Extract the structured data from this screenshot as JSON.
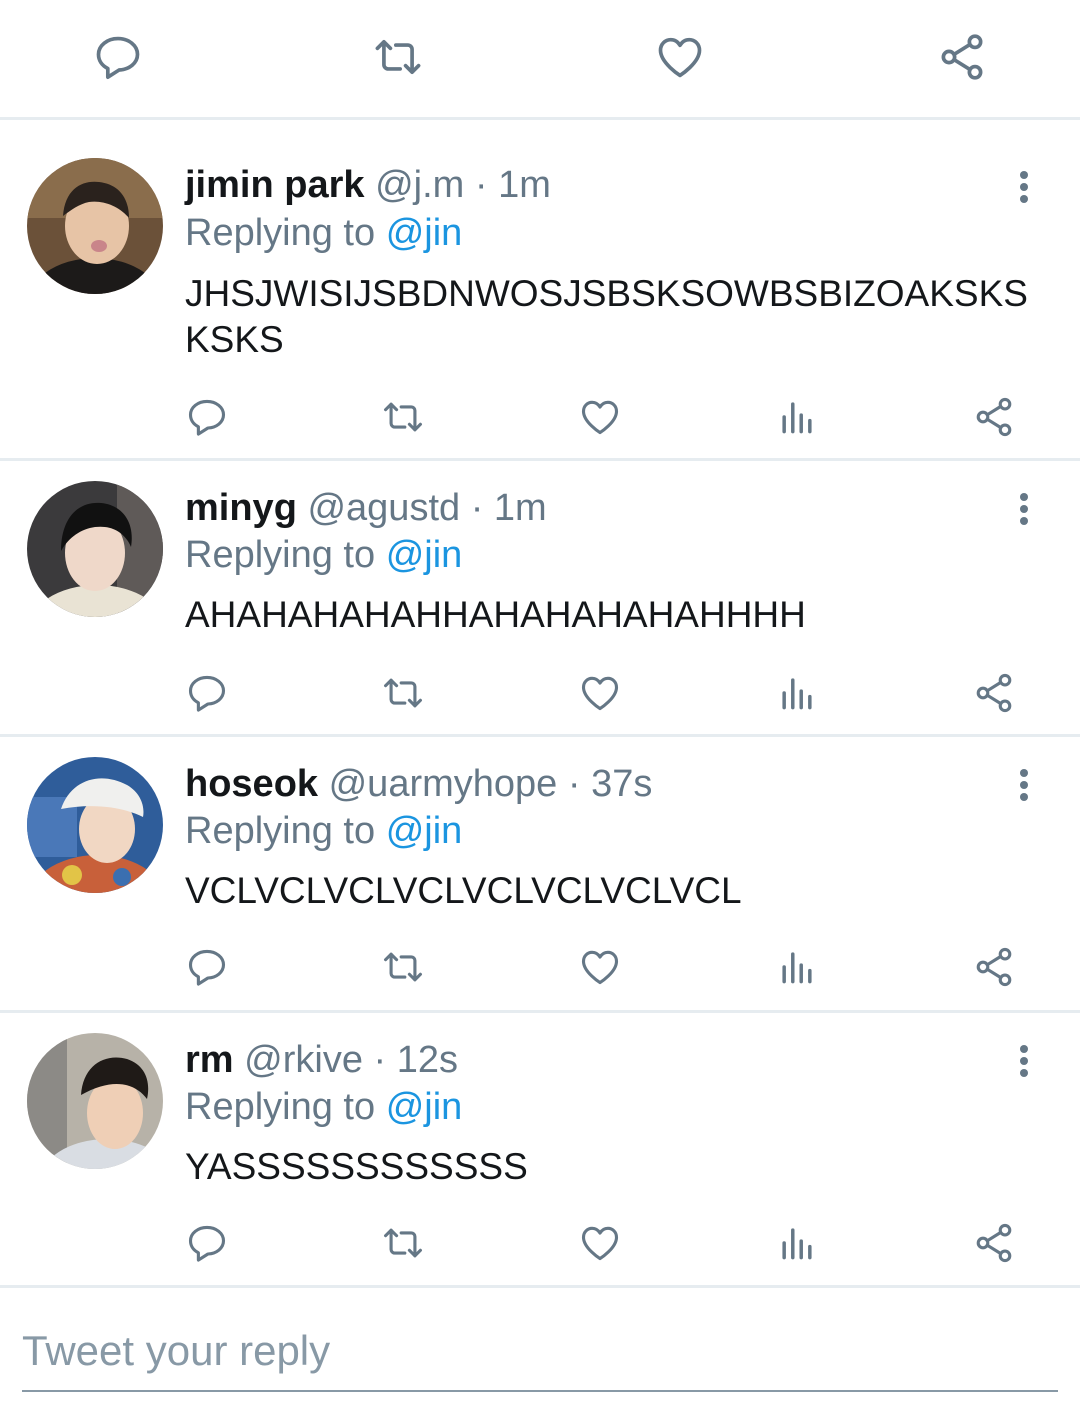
{
  "top_actions": {
    "icons": [
      "reply-icon",
      "retweet-icon",
      "like-icon",
      "share-icon"
    ]
  },
  "tweets": [
    {
      "name": "jimin park",
      "handle": "@j.m",
      "separator": "·",
      "time": "1m",
      "replying_prefix": "Replying to",
      "replying_to": "@jin",
      "text": "JHSJWISIJSBDNWOSJSBSKSOWBSBIZOAKSKSKSKS"
    },
    {
      "name": "minyg",
      "handle": "@agustd",
      "separator": "·",
      "time": "1m",
      "replying_prefix": "Replying to",
      "replying_to": "@jin",
      "text": "AHAHAHAHAHHAHAHAHAHAHHHH"
    },
    {
      "name": "hoseok",
      "handle": "@uarmyhope",
      "separator": "·",
      "time": "37s",
      "replying_prefix": "Replying to",
      "replying_to": "@jin",
      "text": "VCLVCLVCLVCLVCLVCLVCLVCL"
    },
    {
      "name": "rm",
      "handle": "@rkive",
      "separator": "·",
      "time": "12s",
      "replying_prefix": "Replying to",
      "replying_to": "@jin",
      "text": "YASSSSSSSSSSSS"
    }
  ],
  "reply_box": {
    "placeholder": "Tweet your reply"
  },
  "colors": {
    "icon_gray": "#657786",
    "link_blue": "#1b95e0",
    "divider": "#e6ecf0"
  }
}
